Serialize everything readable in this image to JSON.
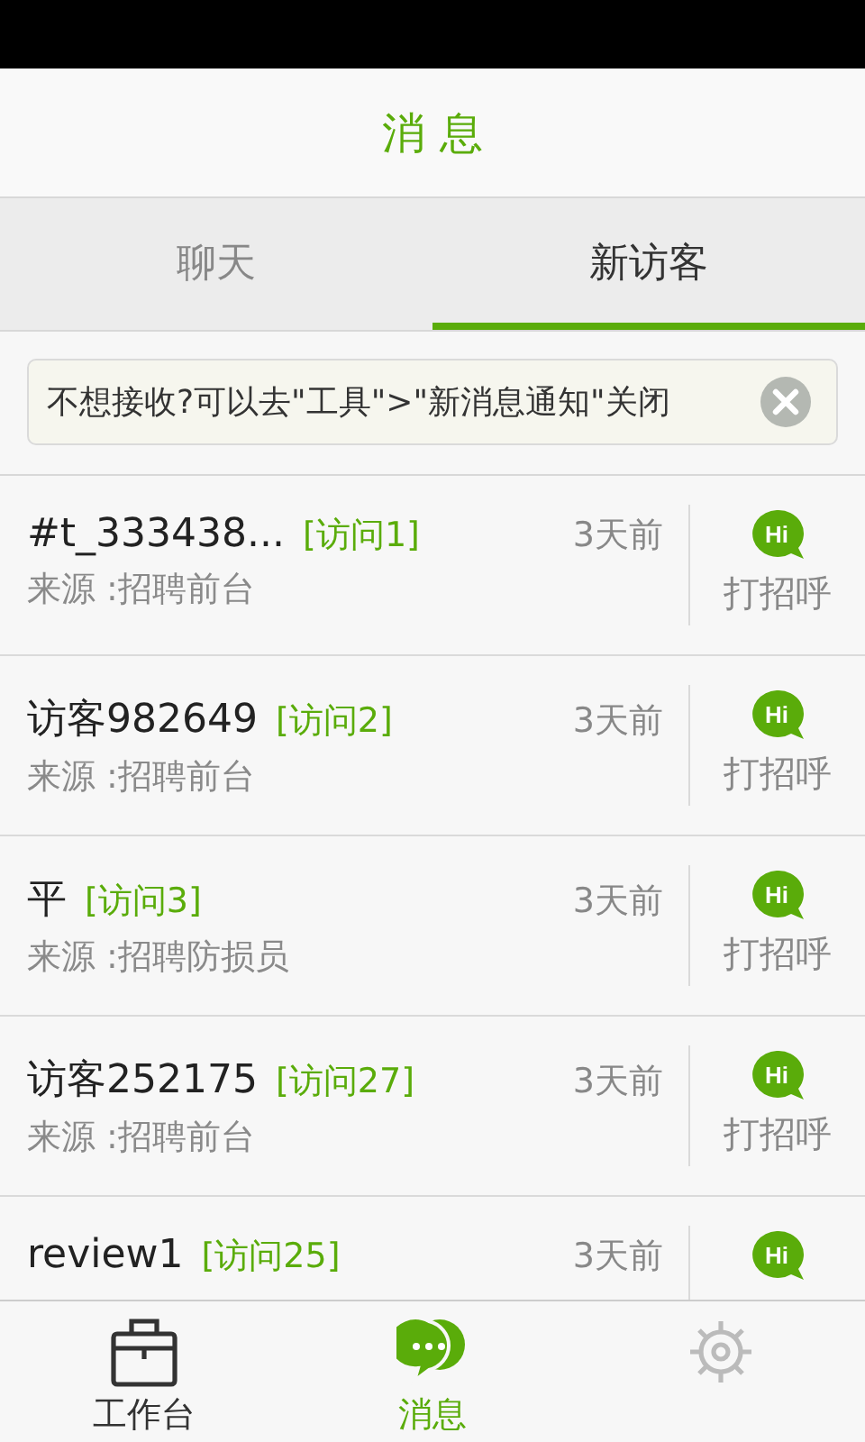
{
  "header": {
    "title": "消 息"
  },
  "tabs": [
    {
      "label": "聊天",
      "selected": false
    },
    {
      "label": "新访客",
      "selected": true
    }
  ],
  "notice": {
    "text": "不想接收?可以去\"工具\">\"新消息通知\"关闭"
  },
  "visitors": [
    {
      "name": "#t_333438...",
      "visits": "[访问1]",
      "time": "3天前",
      "source": "来源 :招聘前台",
      "hi": "Hi",
      "greet": "打招呼"
    },
    {
      "name": "访客982649",
      "visits": "[访问2]",
      "time": "3天前",
      "source": "来源 :招聘前台",
      "hi": "Hi",
      "greet": "打招呼"
    },
    {
      "name": "平",
      "visits": "[访问3]",
      "time": "3天前",
      "source": "来源 :招聘防损员",
      "hi": "Hi",
      "greet": "打招呼"
    },
    {
      "name": "访客252175",
      "visits": "[访问27]",
      "time": "3天前",
      "source": "来源 :招聘前台",
      "hi": "Hi",
      "greet": "打招呼"
    },
    {
      "name": "review1",
      "visits": "[访问25]",
      "time": "3天前",
      "hi": "Hi"
    }
  ],
  "nav": [
    {
      "kind": "briefcase",
      "label": "工作台",
      "selected": false
    },
    {
      "kind": "chat",
      "label": "消息",
      "selected": true
    },
    {
      "kind": "gear",
      "selected": false
    }
  ]
}
